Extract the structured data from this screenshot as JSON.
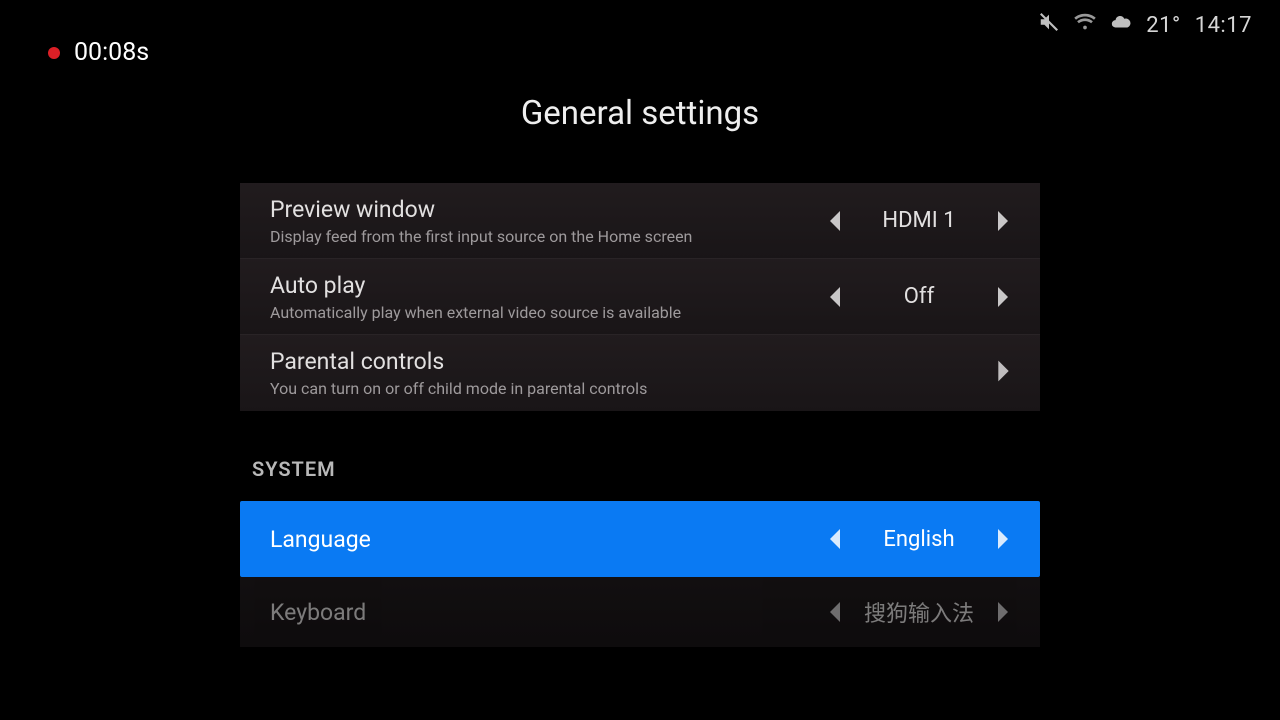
{
  "statusbar": {
    "recording_time": "00:08s",
    "temperature": "21°",
    "time": "14:17"
  },
  "page": {
    "title": "General settings",
    "system_header": "SYSTEM"
  },
  "rows": {
    "preview": {
      "title": "Preview window",
      "desc": "Display feed from the first input source on the Home screen",
      "value": "HDMI 1"
    },
    "autoplay": {
      "title": "Auto play",
      "desc": "Automatically play when external video source is available",
      "value": "Off"
    },
    "parental": {
      "title": "Parental controls",
      "desc": "You can turn on or off child mode in parental controls"
    },
    "language": {
      "title": "Language",
      "value": "English"
    },
    "keyboard": {
      "title": "Keyboard",
      "value": "搜狗输入法"
    }
  }
}
